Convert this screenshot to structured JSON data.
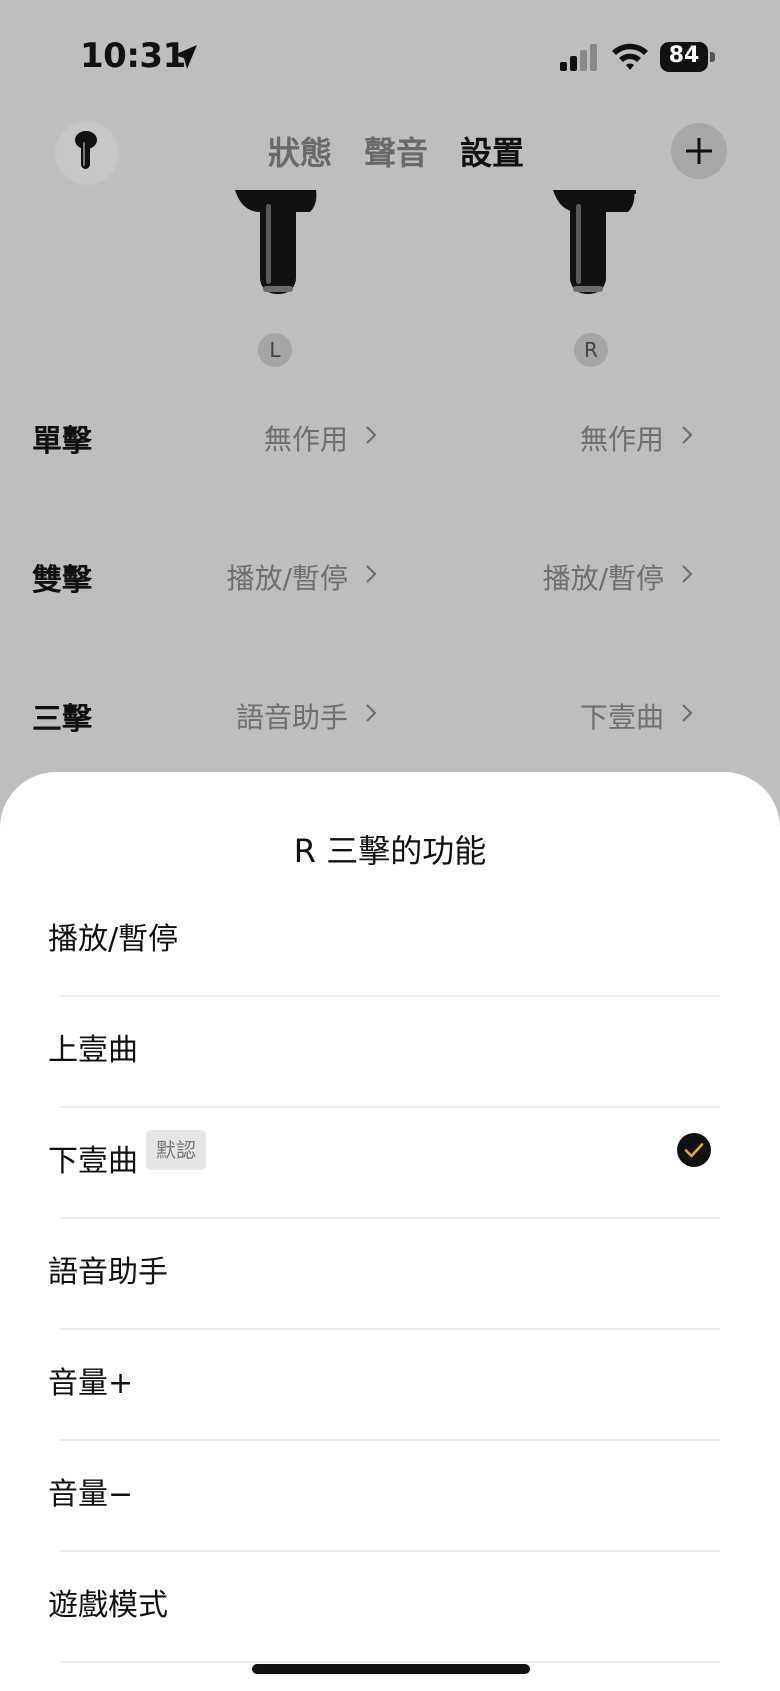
{
  "status_bar": {
    "time": "10:31",
    "battery": "84",
    "icons": [
      "location-arrow-icon",
      "cellular-signal-icon",
      "wifi-icon",
      "battery-icon"
    ]
  },
  "header": {
    "tabs": [
      {
        "label": "狀態",
        "active": false
      },
      {
        "label": "聲音",
        "active": false
      },
      {
        "label": "設置",
        "active": true
      }
    ],
    "add_icon": "plus-icon"
  },
  "earbuds": {
    "left_label": "L",
    "right_label": "R"
  },
  "gestures": [
    {
      "label": "單擊",
      "left": "無作用",
      "right": "無作用"
    },
    {
      "label": "雙擊",
      "left": "播放/暫停",
      "right": "播放/暫停"
    },
    {
      "label": "三擊",
      "left": "語音助手",
      "right": "下壹曲"
    }
  ],
  "sheet": {
    "title": "R 三擊的功能",
    "options": [
      {
        "label": "播放/暫停",
        "selected": false
      },
      {
        "label": "上壹曲",
        "selected": false
      },
      {
        "label": "下壹曲",
        "selected": true,
        "badge": "默認"
      },
      {
        "label": "語音助手",
        "selected": false
      },
      {
        "label": "音量+",
        "selected": false
      },
      {
        "label": "音量−",
        "selected": false
      },
      {
        "label": "遊戲模式",
        "selected": false
      }
    ]
  },
  "colors": {
    "overlay_background": "#bebebe",
    "sheet_background": "#ffffff",
    "check_fill": "#111111",
    "check_mark": "#f5a623"
  }
}
